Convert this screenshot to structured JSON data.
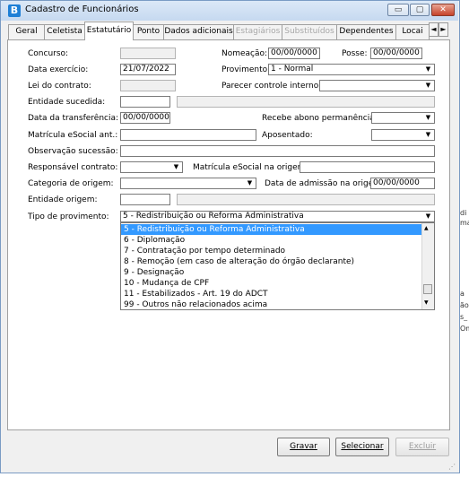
{
  "window": {
    "title": "Cadastro de Funcionários",
    "app_icon_letter": "B",
    "min_glyph": "▭",
    "max_glyph": "▢",
    "close_glyph": "✕"
  },
  "tabs": [
    {
      "label": "Geral",
      "state": "normal"
    },
    {
      "label": "Celetista",
      "state": "normal"
    },
    {
      "label": "Estatutário",
      "state": "active"
    },
    {
      "label": "Ponto",
      "state": "normal"
    },
    {
      "label": "Dados adicionais",
      "state": "normal"
    },
    {
      "label": "Estagiários",
      "state": "disabled"
    },
    {
      "label": "Substituídos",
      "state": "disabled"
    },
    {
      "label": "Dependentes",
      "state": "normal"
    },
    {
      "label": "Locai",
      "state": "normal"
    }
  ],
  "tab_scroll": {
    "left": "◄",
    "right": "►"
  },
  "form": {
    "concurso": {
      "label": "Concurso:",
      "value": ""
    },
    "nomeacao": {
      "label": "Nomeação:",
      "value": "00/00/0000"
    },
    "posse": {
      "label": "Posse:",
      "value": "00/00/0000"
    },
    "data_exercicio": {
      "label": "Data exercício:",
      "value": "21/07/2022"
    },
    "provimento": {
      "label": "Provimento:",
      "value": "1 - Normal"
    },
    "lei_contrato": {
      "label": "Lei do contrato:",
      "value": ""
    },
    "parecer_controle": {
      "label": "Parecer controle interno:",
      "value": ""
    },
    "entidade_sucedida": {
      "label": "Entidade sucedida:",
      "value": "",
      "desc": ""
    },
    "data_transferencia": {
      "label": "Data da transferência:",
      "value": "00/00/0000"
    },
    "recebe_abono": {
      "label": "Recebe abono permanência:",
      "value": ""
    },
    "matricula_esocial_ant": {
      "label": "Matrícula eSocial ant.:",
      "value": ""
    },
    "aposentado": {
      "label": "Aposentado:",
      "value": ""
    },
    "observacao_sucessao": {
      "label": "Observação sucessão:",
      "value": ""
    },
    "responsavel_contrato": {
      "label": "Responsável contrato:",
      "value": ""
    },
    "matricula_esocial_origem": {
      "label": "Matrícula eSocial na origem:",
      "value": ""
    },
    "categoria_origem": {
      "label": "Categoria de origem:",
      "value": ""
    },
    "data_admissao_origem": {
      "label": "Data de admissão na origem:",
      "value": "00/00/0000"
    },
    "entidade_origem": {
      "label": "Entidade origem:",
      "value": "",
      "desc": ""
    },
    "tipo_provimento": {
      "label": "Tipo de provimento:",
      "value": "5 - Redistribuição ou Reforma Administrativa"
    }
  },
  "dropdown_options": [
    "5 - Redistribuição ou Reforma Administrativa",
    "6 - Diplomação",
    "7 - Contratação por tempo determinado",
    "8 - Remoção (em caso de alteração do órgão declarante)",
    "9 - Designação",
    "10 - Mudança de CPF",
    "11 - Estabilizados - Art. 19 do ADCT",
    "99 - Outros não relacionados acima"
  ],
  "dropdown_selected_index": 0,
  "buttons": {
    "gravar": "Gravar",
    "selecionar": "Selecionar",
    "excluir": "Excluir"
  },
  "side_fragments": [
    "di",
    "ma",
    "a",
    "ão",
    "s_",
    "Om"
  ]
}
